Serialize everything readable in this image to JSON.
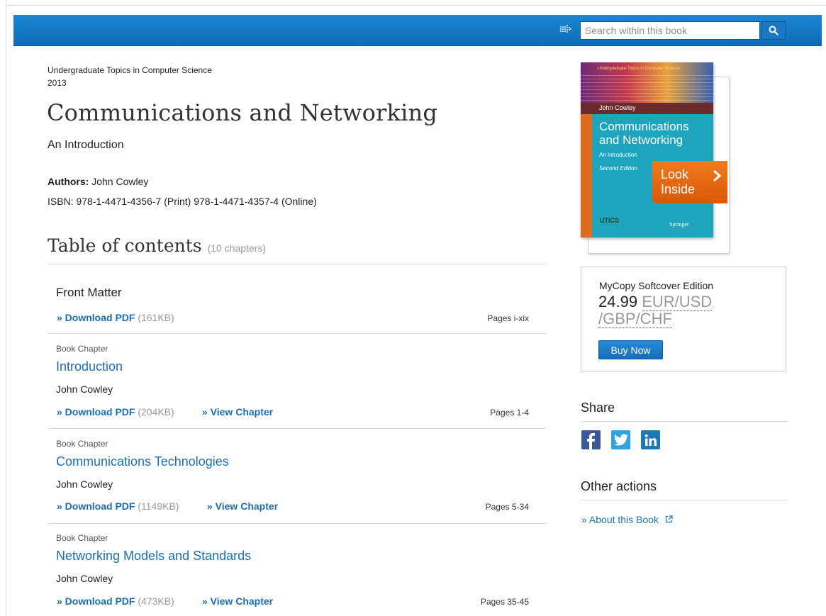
{
  "search": {
    "placeholder": "Search within this book"
  },
  "book": {
    "series": "Undergraduate Topics in Computer Science",
    "year": "2013",
    "title": "Communications and Networking",
    "subtitle": "An Introduction",
    "authors_label": "Authors:",
    "authors": "John Cowley",
    "isbn": "ISBN: 978-1-4471-4356-7 (Print) 978-1-4471-4357-4 (Online)"
  },
  "toc": {
    "heading": "Table of contents",
    "count": "(10 chapters)",
    "front_matter": {
      "title": "Front Matter",
      "download_label": "» Download PDF",
      "size": "(161KB)",
      "pages": "Pages i-xix"
    },
    "chapters": [
      {
        "type": "Book Chapter",
        "title": "Introduction",
        "author": "John Cowley",
        "download_label": "» Download PDF",
        "size": "(204KB)",
        "view_label": "» View Chapter",
        "pages": "Pages 1-4"
      },
      {
        "type": "Book Chapter",
        "title": "Communications Technologies",
        "author": "John Cowley",
        "download_label": "» Download PDF",
        "size": "(1149KB)",
        "view_label": "» View Chapter",
        "pages": "Pages 5-34"
      },
      {
        "type": "Book Chapter",
        "title": "Networking Models and Standards",
        "author": "John Cowley",
        "download_label": "» Download PDF",
        "size": "(473KB)",
        "view_label": "» View Chapter",
        "pages": "Pages 35-45"
      }
    ]
  },
  "cover": {
    "series": "Undergraduate Topics in Computer Science",
    "author": "John Cowley",
    "title_line1": "Communications",
    "title_line2": "and Networking",
    "subtitle": "An Introduction",
    "edition": "Second Edition",
    "publisher": "Springer",
    "logo_text": "UTiCS",
    "look_inside_line1": "Look",
    "look_inside_line2": "Inside"
  },
  "buy": {
    "label": "MyCopy Softcover Edition",
    "price": "24.99",
    "currency_line1": "EUR/USD",
    "currency_line2": "/GBP/CHF",
    "button": "Buy Now"
  },
  "share": {
    "heading": "Share"
  },
  "other_actions": {
    "heading": "Other actions",
    "about": "About this Book"
  },
  "icons": {
    "search": "search-icon",
    "arrow": "dotted-arrow-icon",
    "facebook": "facebook-icon",
    "twitter": "twitter-icon",
    "linkedin": "linkedin-icon",
    "external": "external-link-icon",
    "chevron": "chevron-right-icon"
  },
  "colors": {
    "topbar": "#1a87d4",
    "link": "#1a6fb3",
    "look_inside": "#f07a1d",
    "cover_teal": "#1fa4bd"
  }
}
